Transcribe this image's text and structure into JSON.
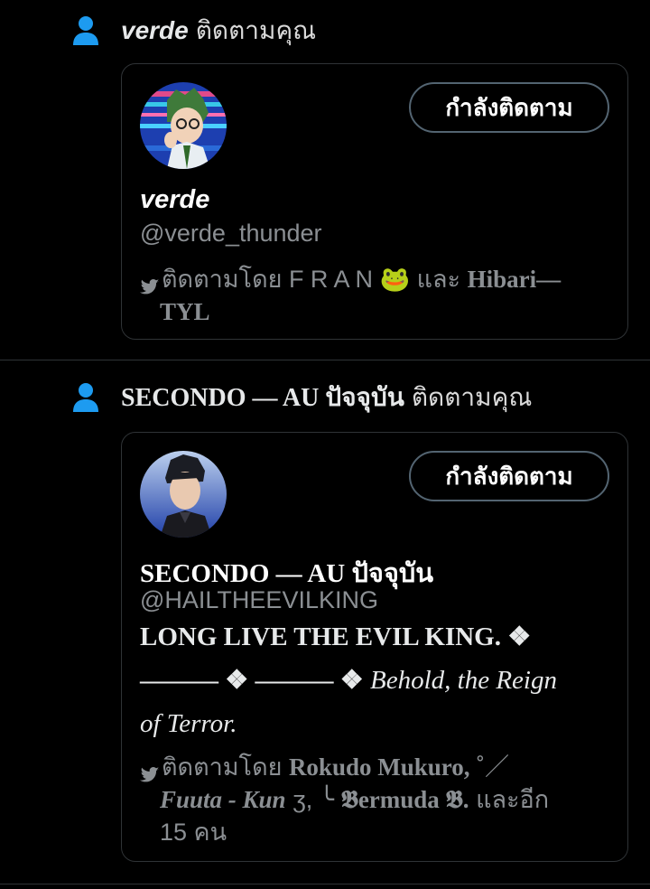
{
  "notifications": [
    {
      "header_name": "verde",
      "header_action": "ติดตามคุณ",
      "card": {
        "button_label": "กำลังติดตาม",
        "name": "verde",
        "handle": "@verde_thunder",
        "followed_by_prefix": "ติดตามโดย",
        "followed_by_line1": "F R A N 🐸 และ",
        "followed_by_bold1": "Hibari—",
        "followed_by_line2": "TYL"
      }
    },
    {
      "header_name": "SECONDO — AU ปัจจุบัน",
      "header_action": "ติดตามคุณ",
      "card": {
        "button_label": "กำลังติดตาม",
        "name": "SECONDO — AU ปัจจุบัน",
        "handle": "@HAILTHEEVILKING",
        "bio_line1": "LONG LIVE THE EVIL KING. ❖",
        "bio_line2_plain": "——— ❖ ——— ❖",
        "bio_line2_italic": "Behold, the Reign",
        "bio_line3": "of Terror.",
        "followed_by_prefix": "ติดตามโดย",
        "followed_by_bold1": "Rokudo Mukuro,",
        "followed_by_sym1": "˚／",
        "followed_by_italic": "Fuuta - Kun",
        "followed_by_mid": "ʒ, ╰",
        "followed_by_gothic": "𝕭ermuda 𝕭.",
        "followed_by_tail": "และอีก",
        "followed_by_count": "15 คน"
      }
    }
  ],
  "colors": {
    "accent_blue": "#1d9bf0",
    "secondary_text": "#8b8f93",
    "divider": "#2f3336"
  },
  "icons": [
    "person-icon",
    "twitter-bird-icon"
  ]
}
